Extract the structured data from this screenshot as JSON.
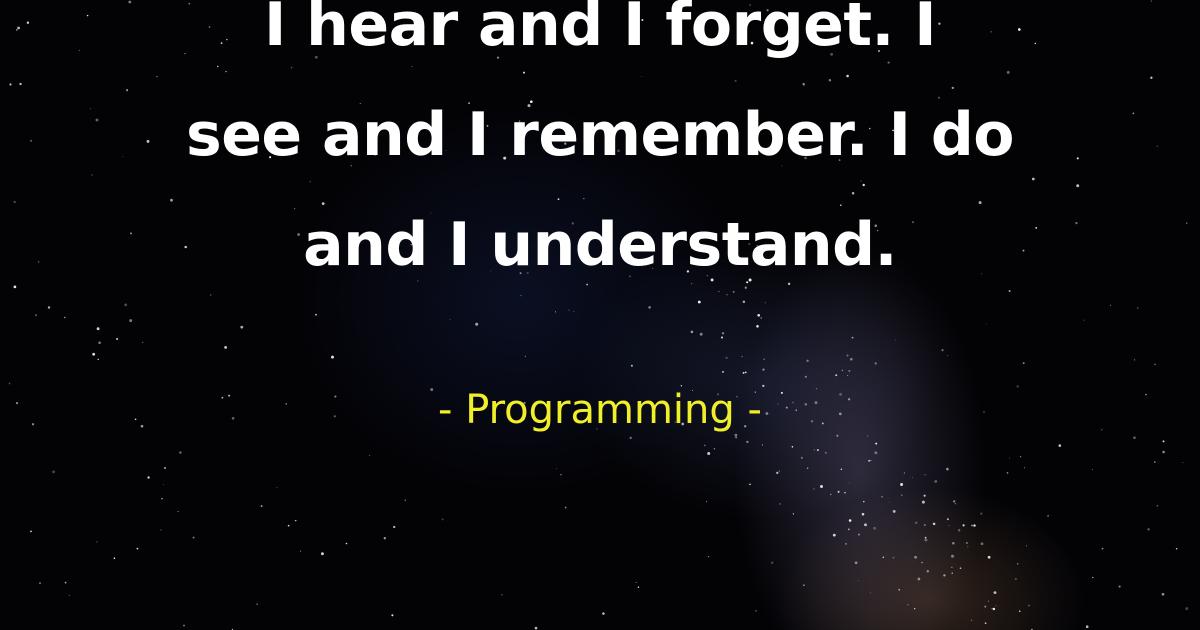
{
  "quote": {
    "lines": [
      "I hear and I forget. I",
      "see and I remember. I do",
      "and I understand."
    ]
  },
  "attribution": "- Programming -",
  "colors": {
    "background": "#030306",
    "quote_text": "#ffffff",
    "attribution_text": "#f1ef2a"
  }
}
